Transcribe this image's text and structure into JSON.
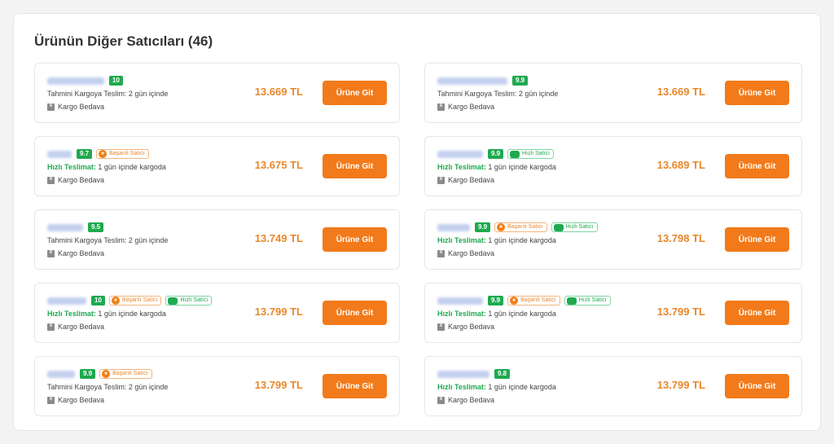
{
  "title": "Ürünün Diğer Satıcıları (46)",
  "labels": {
    "delivery_standard": "Tahmini Kargoya Teslim: 2 gün içinde",
    "fast_label": "Hızlı Teslimat:",
    "fast_text": " 1 gün içinde kargoda",
    "free_shipping": "Kargo Bedava",
    "button": "Ürüne Git",
    "badge_success": "Başarılı Satıcı",
    "badge_fast": "Hızlı Satıcı"
  },
  "colors": {
    "accent": "#f27a1a",
    "price": "#e8872a",
    "score": "#1fa94f"
  },
  "sellers": [
    {
      "score": "10",
      "price": "13.669 TL",
      "fast": false,
      "success": false,
      "fast_seller": false,
      "name_len": 70
    },
    {
      "score": "9.9",
      "price": "13.669 TL",
      "fast": false,
      "success": false,
      "fast_seller": false,
      "name_len": 86
    },
    {
      "score": "9.7",
      "price": "13.675 TL",
      "fast": true,
      "success": true,
      "fast_seller": false,
      "name_len": 30
    },
    {
      "score": "9.9",
      "price": "13.689 TL",
      "fast": true,
      "success": false,
      "fast_seller": true,
      "name_len": 56
    },
    {
      "score": "9.5",
      "price": "13.749 TL",
      "fast": false,
      "success": false,
      "fast_seller": false,
      "name_len": 44
    },
    {
      "score": "9.9",
      "price": "13.798 TL",
      "fast": true,
      "success": true,
      "fast_seller": true,
      "name_len": 40
    },
    {
      "score": "10",
      "price": "13.799 TL",
      "fast": true,
      "success": true,
      "fast_seller": true,
      "name_len": 48
    },
    {
      "score": "9.9",
      "price": "13.799 TL",
      "fast": true,
      "success": true,
      "fast_seller": true,
      "name_len": 56
    },
    {
      "score": "9.9",
      "price": "13.799 TL",
      "fast": false,
      "success": true,
      "fast_seller": false,
      "name_len": 34
    },
    {
      "score": "9.8",
      "price": "13.799 TL",
      "fast": true,
      "success": false,
      "fast_seller": false,
      "name_len": 64
    }
  ]
}
